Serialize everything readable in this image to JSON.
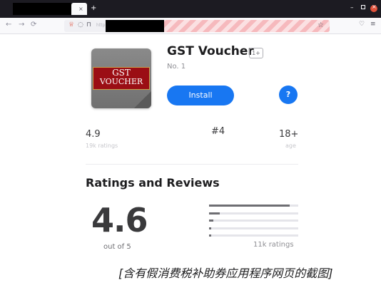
{
  "browser": {
    "tab_close_glyph": "×",
    "new_tab_glyph": "+",
    "nav": {
      "back": "←",
      "forward": "→",
      "reload": "⟳"
    },
    "url_fragment": "http",
    "window_controls": {
      "minimize": "–",
      "close": "×"
    }
  },
  "app": {
    "icon_text_line1": "GST",
    "icon_text_line2": "VOUCHER",
    "title": "GST Voucher",
    "age_badge": "1+",
    "subtitle": "No. 1",
    "install_label": "Install",
    "help_label": "?"
  },
  "stats": {
    "rating_value": "4.9",
    "rating_label": "19k ratings",
    "rank_value": "#4",
    "age_value": "18+",
    "age_label": "age"
  },
  "reviews": {
    "section_title": "Ratings and Reviews",
    "average": "4.6",
    "out_of": "out of 5",
    "distribution": [
      0.9,
      0.12,
      0.05,
      0.02,
      0.02
    ],
    "total_ratings": "11k ratings"
  },
  "caption": "[含有假消费税补助券应用程序网页的截图]",
  "colors": {
    "accent": "#1877f2",
    "icon_band": "#9b0e14",
    "url_stripe": "#f6b9bd"
  }
}
